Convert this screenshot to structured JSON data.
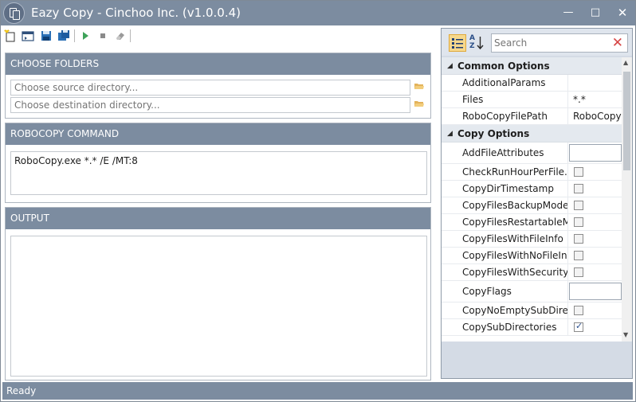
{
  "window": {
    "title": "Eazy Copy - Cinchoo Inc. (v1.0.0.4)",
    "minimize_glyph": "—",
    "maximize_glyph": "□",
    "close_glyph": "✕"
  },
  "toolbar": {
    "items": [
      {
        "name": "new-icon"
      },
      {
        "name": "open-icon"
      },
      {
        "name": "save-icon"
      },
      {
        "name": "save-as-icon"
      },
      {
        "name": "run-icon"
      },
      {
        "name": "stop-icon"
      },
      {
        "name": "clear-icon"
      }
    ]
  },
  "choose_folders": {
    "header": "CHOOSE FOLDERS",
    "source_placeholder": "Choose source directory...",
    "destination_placeholder": "Choose destination directory..."
  },
  "robocopy_command": {
    "header": "ROBOCOPY COMMAND",
    "command": "RoboCopy.exe  *.* /E /MT:8"
  },
  "output": {
    "header": "OUTPUT",
    "text": ""
  },
  "status": {
    "text": "Ready"
  },
  "property_grid": {
    "search_placeholder": "Search",
    "alpha_label_top": "A",
    "alpha_label_bottom": "Z",
    "categories": [
      {
        "name": "Common Options",
        "properties": [
          {
            "name": "AdditionalParams",
            "value": ""
          },
          {
            "name": "Files",
            "value": "*.*"
          },
          {
            "name": "RoboCopyFilePath",
            "value": "RoboCopy"
          }
        ]
      },
      {
        "name": "Copy Options",
        "properties": [
          {
            "name": "AddFileAttributes",
            "value": ""
          },
          {
            "name": "CheckRunHourPerFile...",
            "checked": false
          },
          {
            "name": "CopyDirTimestamp",
            "checked": false
          },
          {
            "name": "CopyFilesBackupMode",
            "checked": false
          },
          {
            "name": "CopyFilesRestartableM...",
            "checked": false
          },
          {
            "name": "CopyFilesWithFileInfo",
            "checked": false
          },
          {
            "name": "CopyFilesWithNoFileIn...",
            "checked": false
          },
          {
            "name": "CopyFilesWithSecurity",
            "checked": false
          },
          {
            "name": "CopyFlags",
            "value": ""
          },
          {
            "name": "CopyNoEmptySubDire...",
            "checked": false
          },
          {
            "name": "CopySubDirectories",
            "checked": true
          }
        ]
      }
    ]
  },
  "colors": {
    "header_bg": "#7c8ca0",
    "status_bg": "#7c8ca0",
    "panel_border": "#aeb6c0"
  }
}
